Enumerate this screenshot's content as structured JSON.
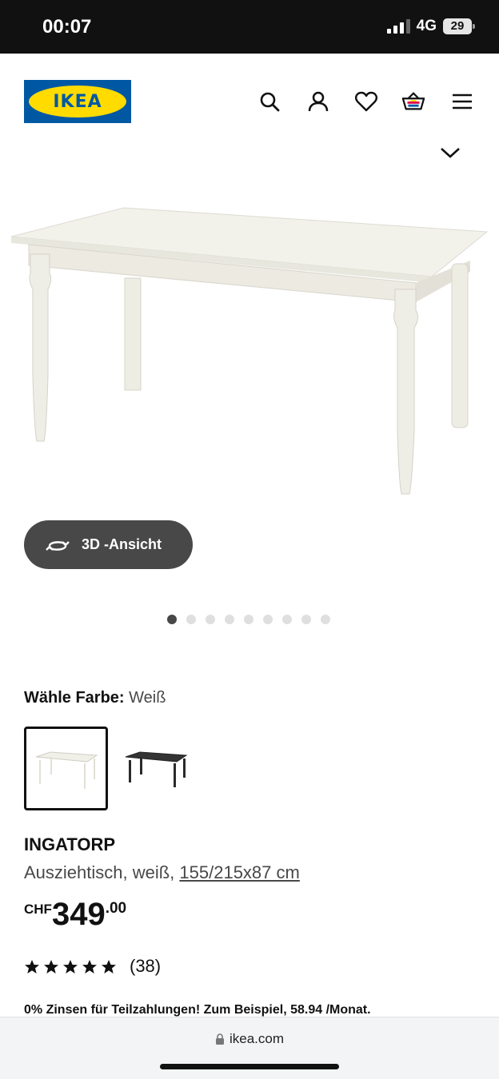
{
  "status_bar": {
    "time": "00:07",
    "network": "4G",
    "battery": "29"
  },
  "header": {
    "logo_text": "IKEA"
  },
  "hero": {
    "view_3d_label": "3D -Ansicht",
    "image_count": 9,
    "active_index": 0
  },
  "color_selector": {
    "label": "Wähle Farbe:",
    "selected_value": "Weiß",
    "options": [
      "white",
      "black"
    ]
  },
  "product": {
    "name": "INGATORP",
    "description": "Ausziehtisch, weiß, ",
    "dimensions": "155/215x87 cm",
    "currency": "CHF",
    "price_int": "349",
    "price_dec": ".00",
    "rating_value": 5,
    "rating_count": "(38)"
  },
  "promo_text": "0% Zinsen für Teilzahlungen! Zum Beispiel, 58.94 /Monat.",
  "browser": {
    "url": "ikea.com"
  },
  "colors": {
    "ikea_blue": "#0058a3",
    "ikea_yellow": "#ffdb00",
    "button_gray": "#484848"
  }
}
